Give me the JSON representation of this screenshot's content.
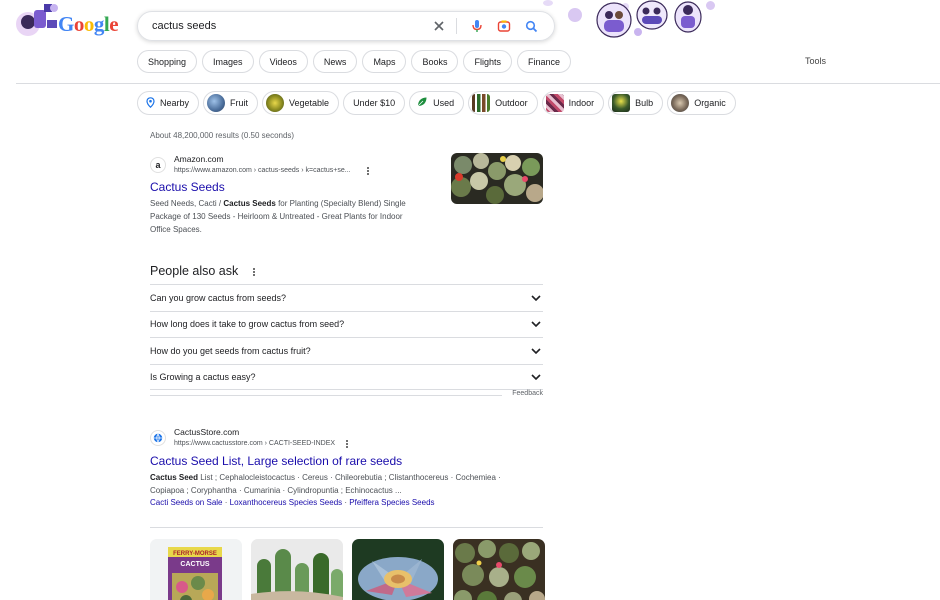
{
  "header": {
    "logo_text": "Google",
    "search": {
      "value": "cactus seeds",
      "clear_icon": "close-icon",
      "voice_icon": "mic-icon",
      "lens_icon": "camera-icon",
      "search_icon": "search-icon"
    }
  },
  "tabs": [
    "Shopping",
    "Images",
    "Videos",
    "News",
    "Maps",
    "Books",
    "Flights",
    "Finance"
  ],
  "tools_label": "Tools",
  "chips": [
    {
      "label": "Nearby",
      "thumb": "location-pin-icon"
    },
    {
      "label": "Fruit",
      "thumb": "image"
    },
    {
      "label": "Vegetable",
      "thumb": "image"
    },
    {
      "label": "Under $10",
      "thumb": ""
    },
    {
      "label": "Used",
      "thumb": "leaf-icon"
    },
    {
      "label": "Outdoor",
      "thumb": "image"
    },
    {
      "label": "Indoor",
      "thumb": "image"
    },
    {
      "label": "Bulb",
      "thumb": "image"
    },
    {
      "label": "Organic",
      "thumb": "image"
    }
  ],
  "stats": "About 48,200,000 results (0.50 seconds)",
  "result1": {
    "favicon": "a",
    "site": "Amazon.com",
    "url": "https://www.amazon.com › cactus-seeds › k=cactus+se...",
    "title": "Cactus Seeds",
    "snippet_lines": [
      [
        "Seed Needs, Cacti / ",
        "Cactus Seeds",
        " for Planting (Specialty Blend) Single"
      ],
      [
        "Package of 130 Seeds - Heirloom & Untreated - Great Plants for Indoor"
      ],
      [
        "Office Spaces."
      ]
    ]
  },
  "paa": {
    "title": "People also ask",
    "questions": [
      "Can you grow cactus from seeds?",
      "How long does it take to grow cactus from seed?",
      "How do you get seeds from cactus fruit?",
      "Is Growing a cactus easy?"
    ],
    "feedback": "Feedback"
  },
  "result2": {
    "site": "CactusStore.com",
    "url": "https://www.cactusstore.com › CACTI-SEED-INDEX",
    "title": "Cactus Seed List, Large selection of rare seeds",
    "snippet_lines": [
      [
        "Cactus Seed",
        " List ; Cephalocleistocactus · Cereus · Chileorebutia ; Clistanthocereus · Cochemiea ·"
      ],
      [
        "Copiapoa ; Coryphantha · Cumarinia · Cylindropuntia ; Echinocactus ..."
      ]
    ],
    "sublinks": [
      "Cacti Seeds on Sale",
      "Loxanthocereus Species Seeds",
      "Pfeiffera Species Seeds"
    ]
  },
  "image_results": {
    "packet_brand": "FERRY-MORSE",
    "packet_label": "CACTUS"
  },
  "colors": {
    "link": "#1a0dab",
    "text": "#202124",
    "muted": "#4d5156",
    "border": "#dadce0"
  }
}
